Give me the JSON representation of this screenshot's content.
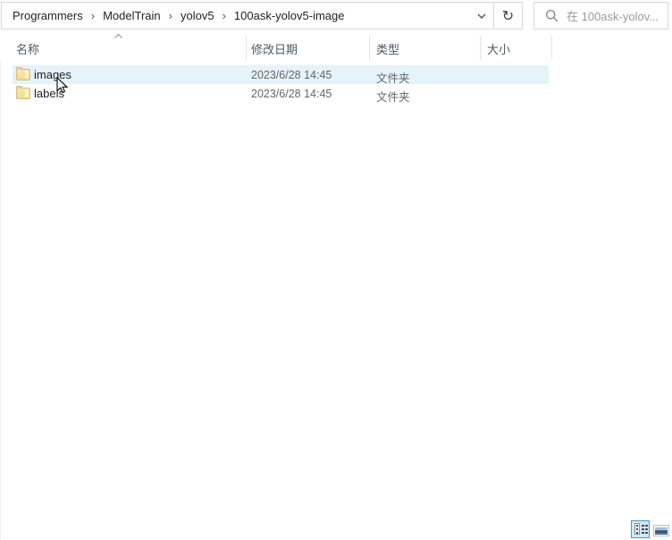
{
  "address_bar": {
    "breadcrumbs": [
      "Programmers",
      "ModelTrain",
      "yolov5",
      "100ask-yolov5-image"
    ],
    "separator": "›",
    "refresh_glyph": "↻"
  },
  "search": {
    "placeholder": "在 100ask-yolov..."
  },
  "list": {
    "columns": [
      {
        "label": "名称"
      },
      {
        "label": "修改日期"
      },
      {
        "label": "类型"
      },
      {
        "label": "大小"
      }
    ],
    "sort": {
      "column": "名称",
      "direction": "ascending"
    },
    "rows": [
      {
        "name": "images",
        "date_modified": "2023/6/28 14:45",
        "type": "文件夹",
        "size": "",
        "hovered": true
      },
      {
        "name": "labels",
        "date_modified": "2023/6/28 14:45",
        "type": "文件夹",
        "size": "",
        "hovered": false
      }
    ]
  },
  "status_bar": {
    "view_buttons": [
      {
        "name": "details-view",
        "active": true
      },
      {
        "name": "thumbnail-view",
        "active": false
      }
    ]
  },
  "colors": {
    "row_hover": "#e5f3fb",
    "border": "#d9d9d9",
    "header_text": "#4a5a68",
    "secondary_text": "#666666",
    "folder_yellow": "#f0dc98",
    "view_button_accent": "#4f97cf"
  }
}
